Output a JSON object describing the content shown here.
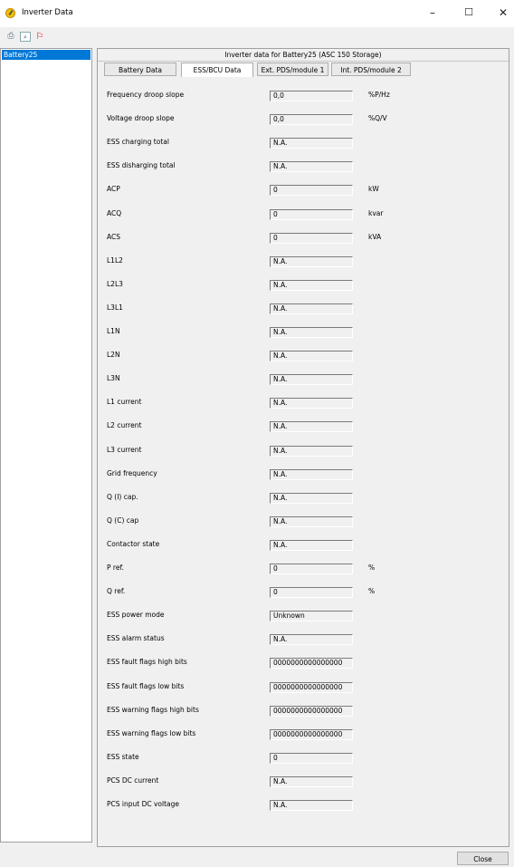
{
  "window": {
    "title": "Inverter Data",
    "min": "–",
    "max": "☐",
    "close": "✕"
  },
  "toolbar": [
    {
      "name": "print-icon",
      "glyph": "⎙"
    },
    {
      "name": "print-preview-icon",
      "glyph": "⌕"
    },
    {
      "name": "pdf-export-icon",
      "glyph": "⚐"
    }
  ],
  "tree": {
    "items": [
      {
        "label": "Battery25",
        "selected": true
      }
    ]
  },
  "panel": {
    "header": "Inverter data for Battery25 (ASC 150 Storage)"
  },
  "tabs": [
    {
      "label": "Battery Data",
      "active": false
    },
    {
      "label": "ESS/BCU Data",
      "active": true
    },
    {
      "label": "Ext. PDS/module 1",
      "active": false
    },
    {
      "label": "Int. PDS/module 2",
      "active": false
    }
  ],
  "rows": [
    {
      "label": "Frequency droop slope",
      "value": "0,0",
      "unit": "%P/Hz"
    },
    {
      "label": "Voltage droop slope",
      "value": "0,0",
      "unit": "%Q/V"
    },
    {
      "label": "ESS charging total",
      "value": "N.A.",
      "unit": ""
    },
    {
      "label": "ESS disharging total",
      "value": "N.A.",
      "unit": ""
    },
    {
      "label": "ACP",
      "value": "0",
      "unit": "kW"
    },
    {
      "label": "ACQ",
      "value": "0",
      "unit": "kvar"
    },
    {
      "label": "ACS",
      "value": "0",
      "unit": "kVA"
    },
    {
      "label": "L1L2",
      "value": "N.A.",
      "unit": ""
    },
    {
      "label": "L2L3",
      "value": "N.A.",
      "unit": ""
    },
    {
      "label": "L3L1",
      "value": "N.A.",
      "unit": ""
    },
    {
      "label": "L1N",
      "value": "N.A.",
      "unit": ""
    },
    {
      "label": "L2N",
      "value": "N.A.",
      "unit": ""
    },
    {
      "label": "L3N",
      "value": "N.A.",
      "unit": ""
    },
    {
      "label": "L1 current",
      "value": "N.A.",
      "unit": ""
    },
    {
      "label": "L2 current",
      "value": "N.A.",
      "unit": ""
    },
    {
      "label": "L3 current",
      "value": "N.A.",
      "unit": ""
    },
    {
      "label": "Grid frequency",
      "value": "N.A.",
      "unit": ""
    },
    {
      "label": "Q (I) cap.",
      "value": "N.A.",
      "unit": ""
    },
    {
      "label": "Q (C) cap",
      "value": "N.A.",
      "unit": ""
    },
    {
      "label": "Contactor state",
      "value": "N.A.",
      "unit": ""
    },
    {
      "label": "P ref.",
      "value": "0",
      "unit": "%"
    },
    {
      "label": "Q ref.",
      "value": "0",
      "unit": "%"
    },
    {
      "label": "ESS power mode",
      "value": "Unknown",
      "unit": ""
    },
    {
      "label": "ESS alarm status",
      "value": "N.A.",
      "unit": ""
    },
    {
      "label": "ESS fault flags high bits",
      "value": "0000000000000000",
      "unit": ""
    },
    {
      "label": "ESS fault flags low bits",
      "value": "0000000000000000",
      "unit": ""
    },
    {
      "label": "ESS warning flags high bits",
      "value": "0000000000000000",
      "unit": ""
    },
    {
      "label": "ESS warning flags low bits",
      "value": "0000000000000000",
      "unit": ""
    },
    {
      "label": "ESS state",
      "value": "0",
      "unit": ""
    },
    {
      "label": "PCS DC current",
      "value": "N.A.",
      "unit": ""
    },
    {
      "label": "PCS input DC voltage",
      "value": "N.A.",
      "unit": ""
    }
  ],
  "footer": {
    "close_label": "Close"
  }
}
